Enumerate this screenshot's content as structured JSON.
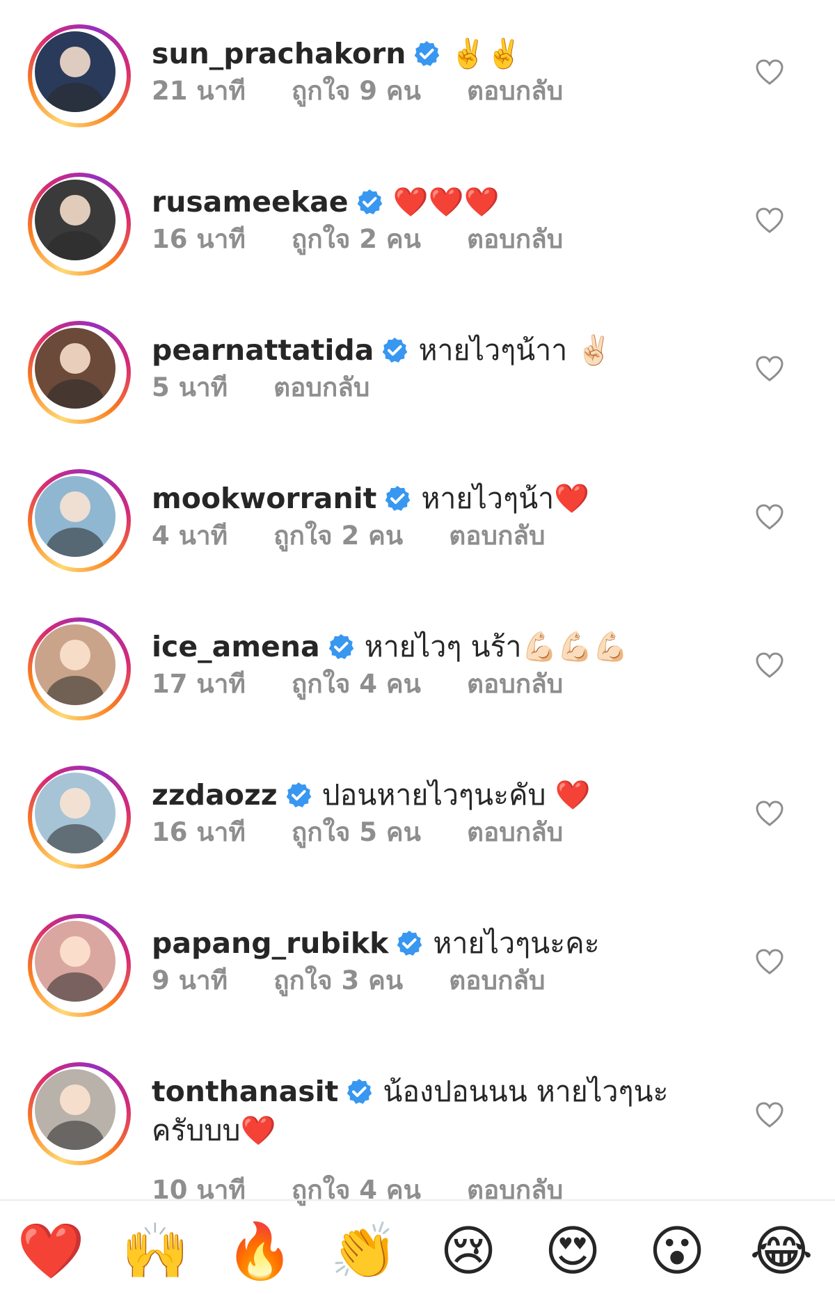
{
  "comments": [
    {
      "username": "sun_prachakorn",
      "text": "✌️✌️",
      "time": "21 นาที",
      "likes": "ถูกใจ 9 คน",
      "reply": "ตอบกลับ",
      "avatar_color": "#2a3a5a"
    },
    {
      "username": "rusameekae",
      "text": "❤️❤️❤️",
      "time": "16 นาที",
      "likes": "ถูกใจ 2 คน",
      "reply": "ตอบกลับ",
      "avatar_color": "#3a3a3a"
    },
    {
      "username": "pearnattatida",
      "text": "หายไวๆน้าา ✌🏻",
      "time": "5 นาที",
      "likes": "",
      "reply": "ตอบกลับ",
      "avatar_color": "#6b4a3a"
    },
    {
      "username": "mookworranit",
      "text": "หายไวๆน้า❤️",
      "time": "4 นาที",
      "likes": "ถูกใจ 2 คน",
      "reply": "ตอบกลับ",
      "avatar_color": "#8fb7d1"
    },
    {
      "username": "ice_amena",
      "text": "หายไวๆ นร้า💪🏻💪🏻💪🏻",
      "time": "17 นาที",
      "likes": "ถูกใจ 4 คน",
      "reply": "ตอบกลับ",
      "avatar_color": "#c9a48a"
    },
    {
      "username": "zzdaozz",
      "text": "ปอนหายไวๆนะคับ ❤️",
      "time": "16 นาที",
      "likes": "ถูกใจ 5 คน",
      "reply": "ตอบกลับ",
      "avatar_color": "#a7c4d6"
    },
    {
      "username": "papang_rubikk",
      "text": "หายไวๆนะคะ",
      "time": "9 นาที",
      "likes": "ถูกใจ 3 คน",
      "reply": "ตอบกลับ",
      "avatar_color": "#d9a7a0"
    },
    {
      "username": "tonthanasit",
      "text": "น้องปอนนน หายไวๆนะครับบบ❤️",
      "time": "10 นาที",
      "likes": "ถูกใจ 4 คน",
      "reply": "ตอบกลับ",
      "avatar_color": "#b9b2aa"
    }
  ],
  "emoji_bar": [
    "❤️",
    "🙌",
    "🔥",
    "👏",
    "😢",
    "😍",
    "😮",
    "😂"
  ],
  "colors": {
    "verified": "#3897f0",
    "meta": "#8e8e8e",
    "text": "#262626"
  }
}
